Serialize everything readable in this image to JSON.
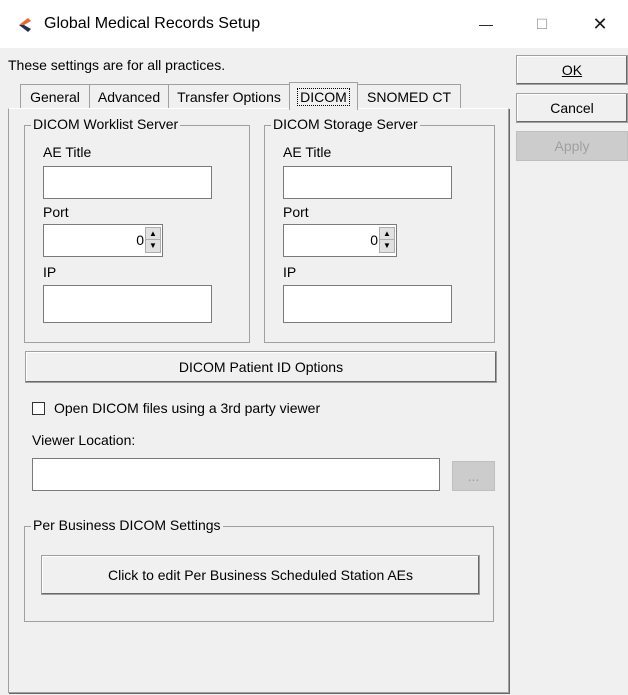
{
  "window": {
    "title": "Global Medical Records Setup",
    "minimize_glyph": "—",
    "maximize_glyph": "☐",
    "close_glyph": "✕"
  },
  "description": "These settings are for all practices.",
  "buttons": {
    "ok": "OK",
    "cancel": "Cancel",
    "apply": "Apply"
  },
  "tabs": [
    {
      "label": "General"
    },
    {
      "label": "Advanced"
    },
    {
      "label": "Transfer Options"
    },
    {
      "label": "DICOM"
    },
    {
      "label": "SNOMED CT"
    }
  ],
  "worklist": {
    "title": "DICOM Worklist Server",
    "ae_label": "AE Title",
    "ae_value": "",
    "port_label": "Port",
    "port_value": "0",
    "ip_label": "IP",
    "ip_value": ""
  },
  "storage": {
    "title": "DICOM Storage Server",
    "ae_label": "AE Title",
    "ae_value": "",
    "port_label": "Port",
    "port_value": "0",
    "ip_label": "IP",
    "ip_value": ""
  },
  "patient_id_button": "DICOM Patient ID Options",
  "third_party": {
    "checkbox_label": "Open DICOM files using a 3rd party viewer",
    "checked": false,
    "viewer_label": "Viewer Location:",
    "viewer_value": "",
    "browse_label": "..."
  },
  "per_business": {
    "title": "Per Business DICOM Settings",
    "button": "Click to edit Per Business Scheduled Station AEs"
  },
  "icons": {
    "app": "dental-tooth-icon",
    "spin_up": "▲",
    "spin_down": "▼"
  },
  "colors": {
    "icon_orange": "#e8692a",
    "icon_navy": "#1f2f57"
  }
}
